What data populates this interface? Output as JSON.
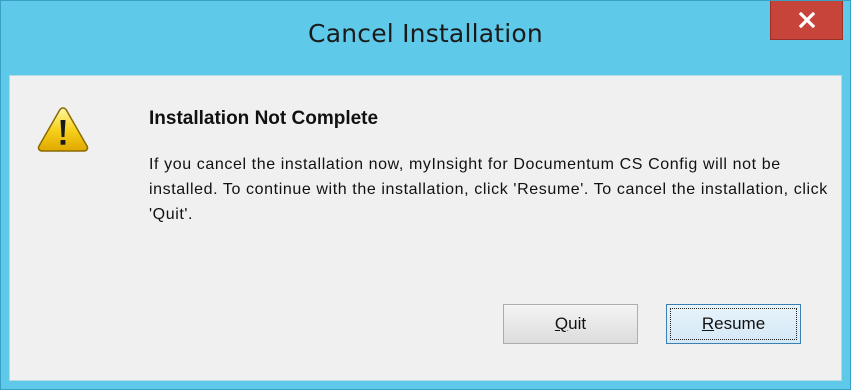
{
  "window": {
    "title": "Cancel Installation",
    "close_icon": "close-icon",
    "colors": {
      "titlebar": "#5fc9ea",
      "close_button": "#c7443b",
      "client_bg": "#f0f0f0"
    }
  },
  "dialog": {
    "icon": "warning-icon",
    "heading": "Installation Not Complete",
    "message": "If you cancel the installation now, myInsight for Documentum CS Config will not be installed.  To continue with the installation, click 'Resume'.  To cancel the installation, click 'Quit'."
  },
  "buttons": {
    "quit": {
      "mnemonic": "Q",
      "rest": "uit"
    },
    "resume": {
      "mnemonic": "R",
      "rest": "esume",
      "focused": true
    }
  }
}
